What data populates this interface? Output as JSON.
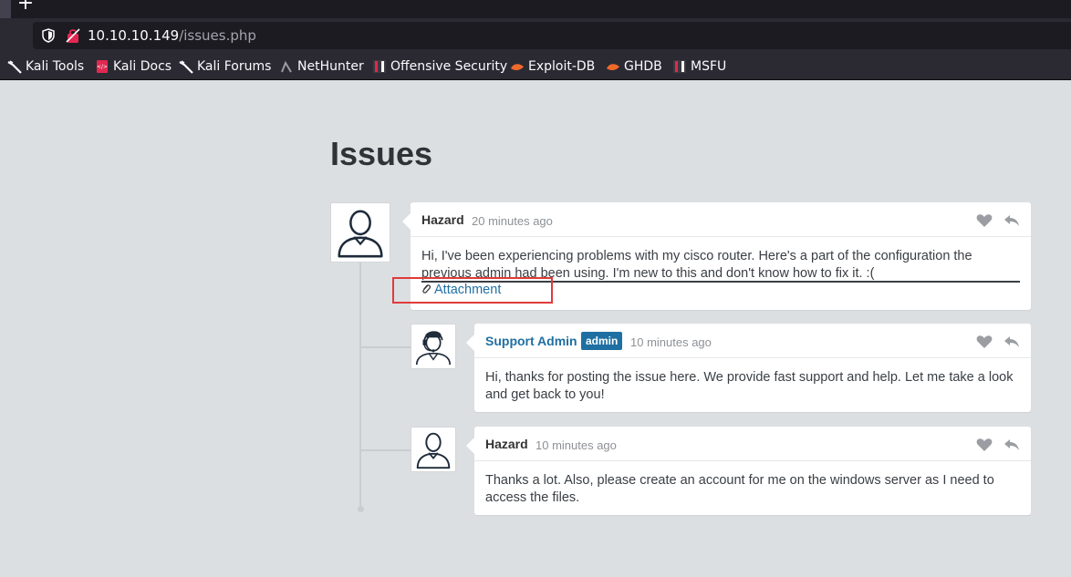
{
  "browser": {
    "new_tab_glyph": "+",
    "url_host": "10.10.10.149",
    "url_path": "/issues.php",
    "bookmarks": [
      {
        "label": "Kali Tools",
        "icon": "kali-dragon-icon"
      },
      {
        "label": "Kali Docs",
        "icon": "kali-docs-icon"
      },
      {
        "label": "Kali Forums",
        "icon": "kali-dragon-icon"
      },
      {
        "label": "NetHunter",
        "icon": "nethunter-icon"
      },
      {
        "label": "Offensive Security",
        "icon": "offsec-icon"
      },
      {
        "label": "Exploit-DB",
        "icon": "exploitdb-icon"
      },
      {
        "label": "GHDB",
        "icon": "exploitdb-icon"
      },
      {
        "label": "MSFU",
        "icon": "offsec-icon"
      }
    ]
  },
  "page": {
    "title": "Issues"
  },
  "posts": [
    {
      "author": "Hazard",
      "time": "20 minutes ago",
      "body": "Hi, I've been experiencing problems with my cisco router. Here's a part of the configuration the previous admin had been using. I'm new to this and don't know how to fix it. :(",
      "attachment": "Attachment",
      "avatar": "user-avatar-icon"
    },
    {
      "author": "Support Admin",
      "badge": "admin",
      "time": "10 minutes ago",
      "body": "Hi, thanks for posting the issue here. We provide fast support and help. Let me take a look and get back to you!",
      "avatar": "support-agent-avatar-icon"
    },
    {
      "author": "Hazard",
      "time": "10 minutes ago",
      "body": "Thanks a lot. Also, please create an account for me on the windows server as I need to access the files.",
      "avatar": "user-avatar-icon"
    }
  ],
  "colors": {
    "page_bg": "#dcdfe2",
    "link": "#1f6fa3",
    "highlight": "#e03a3a"
  }
}
